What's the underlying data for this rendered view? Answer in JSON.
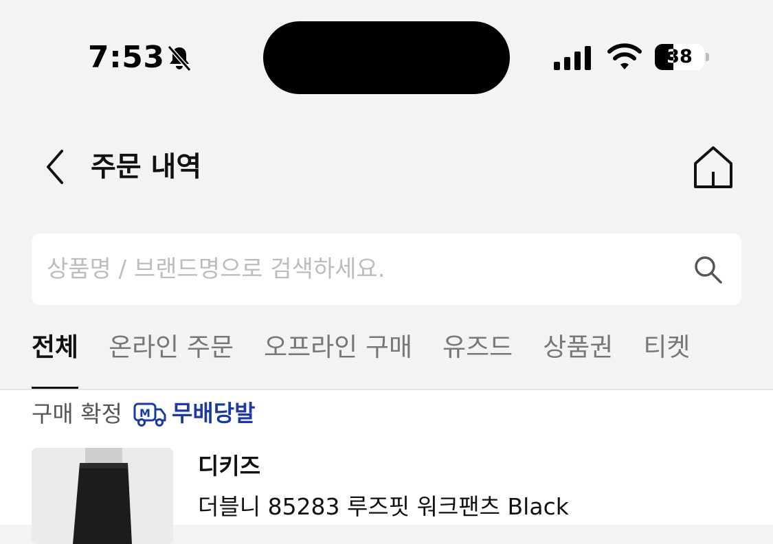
{
  "status_bar": {
    "time": "7:53",
    "battery": "38",
    "battery_level": 0.38,
    "icons": [
      "bell-slash-icon",
      "signal-icon",
      "wifi-icon",
      "battery-icon"
    ]
  },
  "header": {
    "title": "주문 내역",
    "icons": [
      "back-chevron-icon",
      "home-icon"
    ]
  },
  "search": {
    "placeholder": "상품명 / 브랜드명으로 검색하세요.",
    "value": "",
    "icon": "search-icon"
  },
  "tabs": [
    {
      "label": "전체",
      "active": true
    },
    {
      "label": "온라인 주문",
      "active": false
    },
    {
      "label": "오프라인 구매",
      "active": false
    },
    {
      "label": "유즈드",
      "active": false
    },
    {
      "label": "상품권",
      "active": false
    },
    {
      "label": "티켓",
      "active": false
    }
  ],
  "orders": [
    {
      "status": "구매 확정",
      "badge_icon_text": "M",
      "shipping_label": "무배당발",
      "brand": "디키즈",
      "product_name": "더블니 85283 루즈핏 워크팬츠 Black"
    }
  ],
  "colors": {
    "background": "#f3f3f3",
    "shipping_accent": "#1a3aa0",
    "active_tab": "#111111",
    "inactive_tab": "#777777"
  }
}
